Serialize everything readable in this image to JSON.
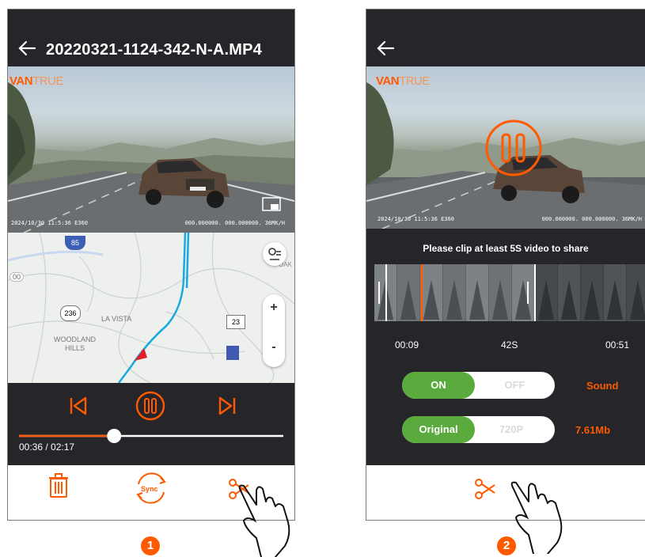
{
  "colors": {
    "accent": "#ff5a00",
    "dark_bg": "#25252a",
    "toggle_on": "#5aaa3e"
  },
  "screen1": {
    "title": "20220321-1124-342-N-A.MP4",
    "logo_a": "VAN",
    "logo_b": "TRUE",
    "video_timestamp": "2024/10/30  11:5:36  E360",
    "video_coords": "000.000000.  000.000000.  36MK/H",
    "map_labels": {
      "la_vista": "LA VISTA",
      "woodland": "WOODLAND",
      "hills": "HILLS",
      "oak": "OAK",
      "road236": "236",
      "road23": "23",
      "road85": "85",
      "road00": "00",
      "zoom_in": "+",
      "zoom_out": "-"
    },
    "progress_fraction": 0.36,
    "time_label": "00:36 / 02:17",
    "icons": [
      "back-arrow-icon",
      "pip-icon",
      "map-layers-icon",
      "prev-icon",
      "pause-icon",
      "next-icon",
      "trash-icon",
      "sync-icon",
      "scissors-icon",
      "hand-pointer-icon"
    ],
    "sync_label": "Sync",
    "step": "1"
  },
  "screen2": {
    "logo_a": "VAN",
    "logo_b": "TRUE",
    "video_timestamp": "2024/10/30  11:5:36  E360",
    "video_coords": "000.000000.  000.000000.  36MK/H",
    "clip_hint": "Please clip at least 5S video to share",
    "start_time": "00:09",
    "duration": "42S",
    "end_time": "00:51",
    "sound_toggle": {
      "on": "ON",
      "off": "OFF",
      "label": "Sound"
    },
    "quality_toggle": {
      "on": "Original",
      "off": "720P",
      "size": "7.61Mb"
    },
    "step": "2"
  }
}
